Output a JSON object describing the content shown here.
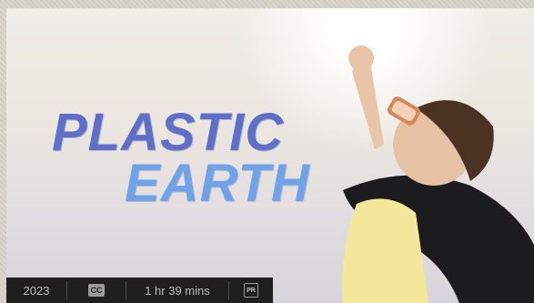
{
  "poster": {
    "title_line_1": "PLASTIC",
    "title_line_2": "EARTH"
  },
  "info_bar": {
    "year": "2023",
    "cc_icon": "closed-captions-icon",
    "cc_label": "CC",
    "duration": "1 hr 39 mins",
    "rating_icon": "rating-badge-icon",
    "rating_label": "PR"
  },
  "colors": {
    "title_line_1": "#5f6fc7",
    "title_line_2": "#6fa2e6",
    "info_bar_bg": "#1f1f20",
    "info_text": "#bdbdbd"
  }
}
